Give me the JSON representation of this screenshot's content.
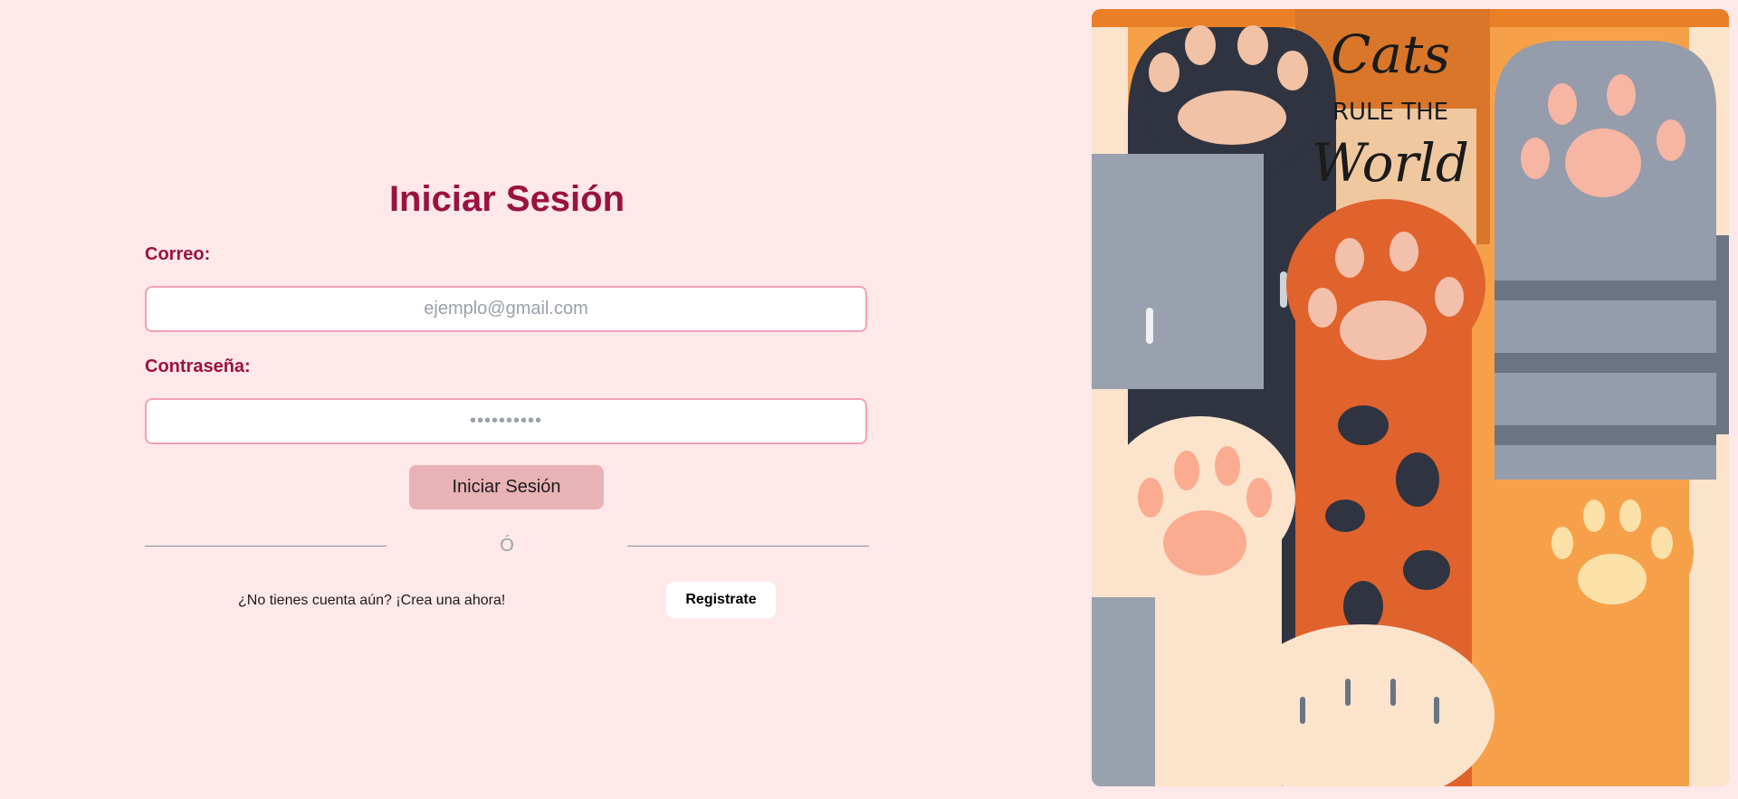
{
  "login": {
    "title": "Iniciar Sesión",
    "email_label": "Correo:",
    "email_placeholder": "ejemplo@gmail.com",
    "password_label": "Contraseña:",
    "password_placeholder": "••••••••••",
    "submit_label": "Iniciar Sesión",
    "divider_text": "Ó",
    "signup_prompt": "¿No tienes cuenta aún? ¡Crea una ahora!",
    "signup_label": "Registrate"
  },
  "hero": {
    "logo_line1": "Cats",
    "logo_line2": "RULE THE",
    "logo_line3": "World"
  },
  "colors": {
    "background": "#ffe8e9",
    "accent": "#9a1240",
    "field_border": "#f3a1b3",
    "submit_button": "#e8b2b6"
  }
}
